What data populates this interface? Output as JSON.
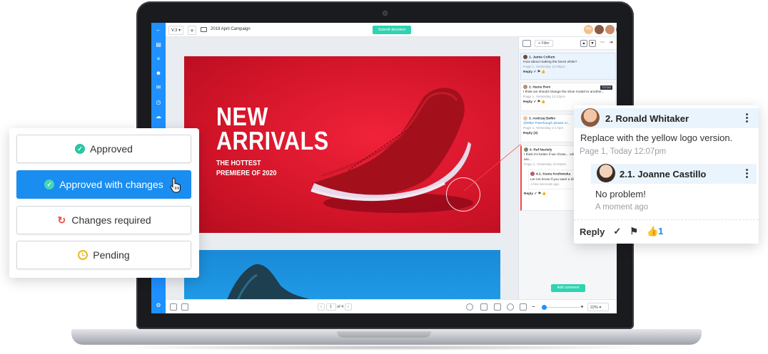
{
  "app": {
    "version": "V.3",
    "campaign_title": "2019 April Campaign",
    "submit_label": "Submit decision",
    "avatar_initials": "HH"
  },
  "banner": {
    "title_line1": "NEW",
    "title_line2": "ARRIVALS",
    "sub_line1": "THE HOTTEST",
    "sub_line2": "PREMIERE OF 2020"
  },
  "toolbar_bottom": {
    "page_current": "1",
    "page_of": "of 4",
    "zoom": "22%"
  },
  "panel": {
    "filter_label": "Filter",
    "add_comment_label": "Add comment",
    "comments": [
      {
        "name": "1. Jamie Collum",
        "text": "How about making the laces white?",
        "meta": "Page 1, Yesterday 10:29pm"
      },
      {
        "name": "2. Hania Reni",
        "text": "I think we should change the shoe model to another...",
        "meta": "Page 1, Yesterday 12:22pm",
        "badge": "TO DO"
      },
      {
        "name": "3. Andrzej Bełko",
        "text": "@Mike Puterbaugh please m...",
        "meta": "Page 1, Yesterday 2:17pm",
        "replies": "Reply (3)"
      },
      {
        "name": "4. Raf Nestely",
        "text": "I think it's better if we chose... which the shoe designed are...",
        "meta": "Page 1, Yesterday 10:02pm"
      },
      {
        "name": "4.1. Kasia Kozłowska",
        "text": "Let me know if you want a diff...",
        "meta": "A few seconds ago"
      }
    ],
    "reply_label": "Reply",
    "like_count": "1"
  },
  "status_options": [
    {
      "label": "Approved",
      "icon": "check-circle-icon"
    },
    {
      "label": "Approved with changes",
      "icon": "check-circle-icon"
    },
    {
      "label": "Changes required",
      "icon": "refresh-icon"
    },
    {
      "label": "Pending",
      "icon": "clock-icon"
    }
  ],
  "comment_card": {
    "author": "2. Ronald Whitaker",
    "text": "Replace with the yellow logo version.",
    "meta": "Page 1, Today 12:07pm",
    "reply_author": "2.1. Joanne Castillo",
    "reply_text": "No problem!",
    "reply_meta": "A moment ago",
    "reply_label": "Reply",
    "like_count": "1"
  },
  "colors": {
    "accent": "#1a8df0",
    "submit": "#2dd4b0",
    "banner_red": "#d11428",
    "banner_blue": "#1a8ad8"
  }
}
